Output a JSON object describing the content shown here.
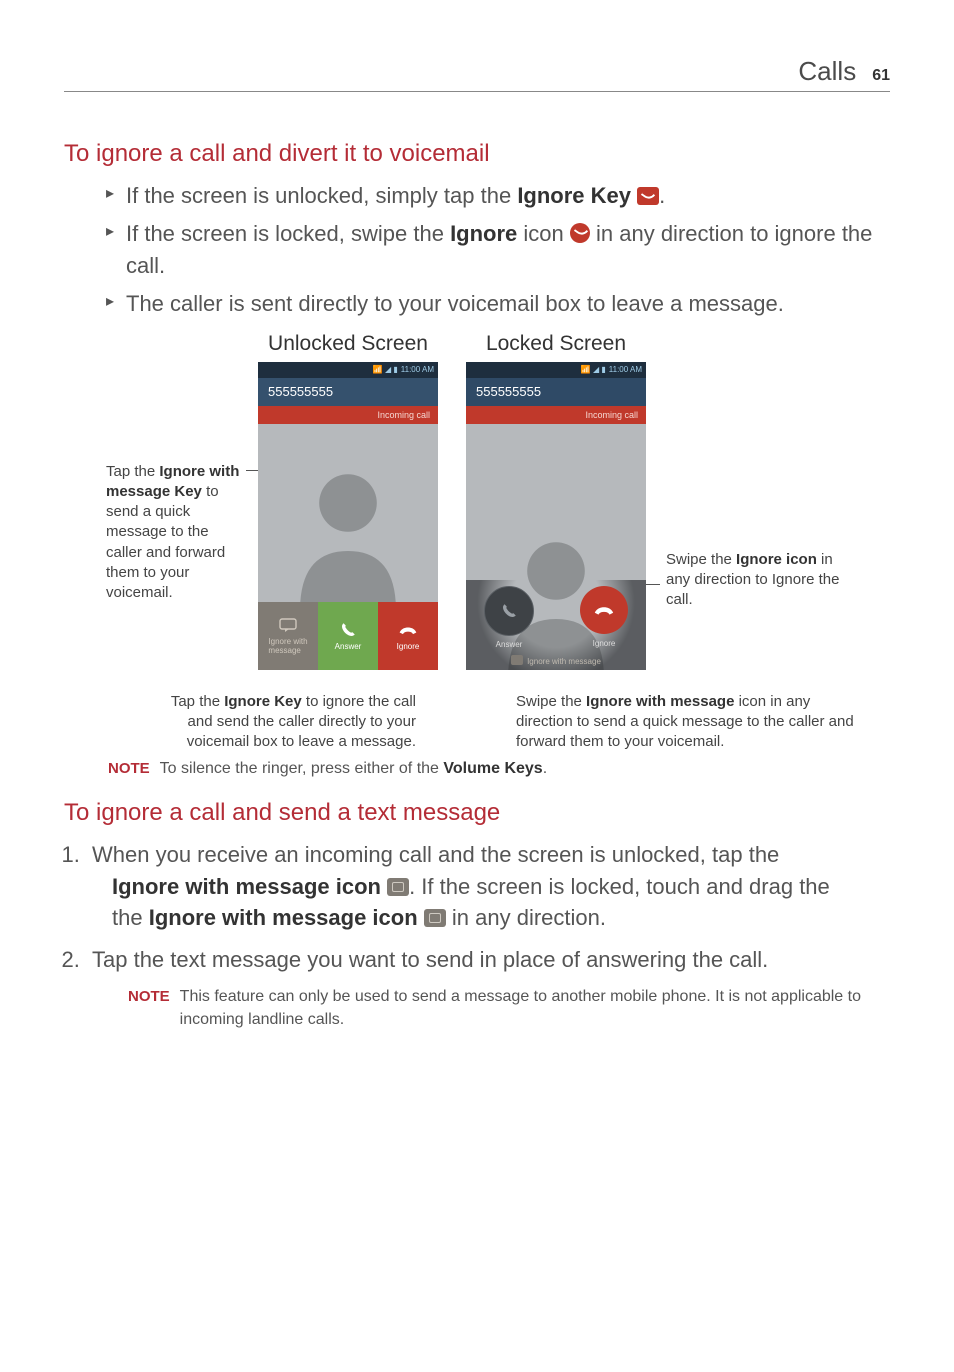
{
  "header": {
    "section": "Calls",
    "page": "61"
  },
  "section1": {
    "heading": "To ignore a call and divert it to voicemail",
    "bullets": {
      "b1a": "If the screen is unlocked, simply tap the ",
      "b1b": "Ignore Key",
      "b1c": ".",
      "b2a": "If the screen is locked, swipe the ",
      "b2b": "Ignore",
      "b2c": " icon ",
      "b2d": " in any direction to ignore the call.",
      "b3": "The caller is sent directly to your voicemail box to leave a message."
    }
  },
  "figures": {
    "unlocked_title": "Unlocked Screen",
    "locked_title": "Locked Screen",
    "status_time": "11:00 AM",
    "phone_number": "555555555",
    "incoming_label": "Incoming call",
    "btn_msg_l1": "Ignore with",
    "btn_msg_l2": "message",
    "btn_ans": "Answer",
    "btn_ign": "Ignore",
    "locked_msg": "Ignore with message"
  },
  "annot": {
    "left_side_a": "Tap the ",
    "left_side_b": "Ignore with message Key",
    "left_side_c": " to send a quick message to the caller and forward them to your voicemail.",
    "below_left_a": "Tap the ",
    "below_left_b": "Ignore Key",
    "below_left_c": " to ignore the call and send the caller directly to your voicemail box to leave a message.",
    "right_side_a": "Swipe the ",
    "right_side_b": "Ignore icon",
    "right_side_c": " in any direction to Ignore the call.",
    "below_right_a": "Swipe the ",
    "below_right_b": "Ignore with message",
    "below_right_c": " icon in any direction to send a quick message to the caller and forward them to your voicemail."
  },
  "note1": {
    "label": "NOTE",
    "a": "To silence the ringer, press either of the ",
    "b": "Volume Keys",
    "c": "."
  },
  "section2": {
    "heading": "To ignore a call and send a text message",
    "s1a": "When you receive an incoming call and the screen is unlocked, tap the ",
    "s1b": "Ignore with message icon",
    "s1c": ". If the screen is locked, touch and drag the ",
    "s1d": "Ignore with message icon",
    "s1e": " in any direction.",
    "s2": "Tap the text message you want to send in place of answering the call."
  },
  "note2": {
    "label": "NOTE",
    "text": "This feature can only be used to send a message to another mobile phone. It is not applicable to incoming landline calls."
  }
}
